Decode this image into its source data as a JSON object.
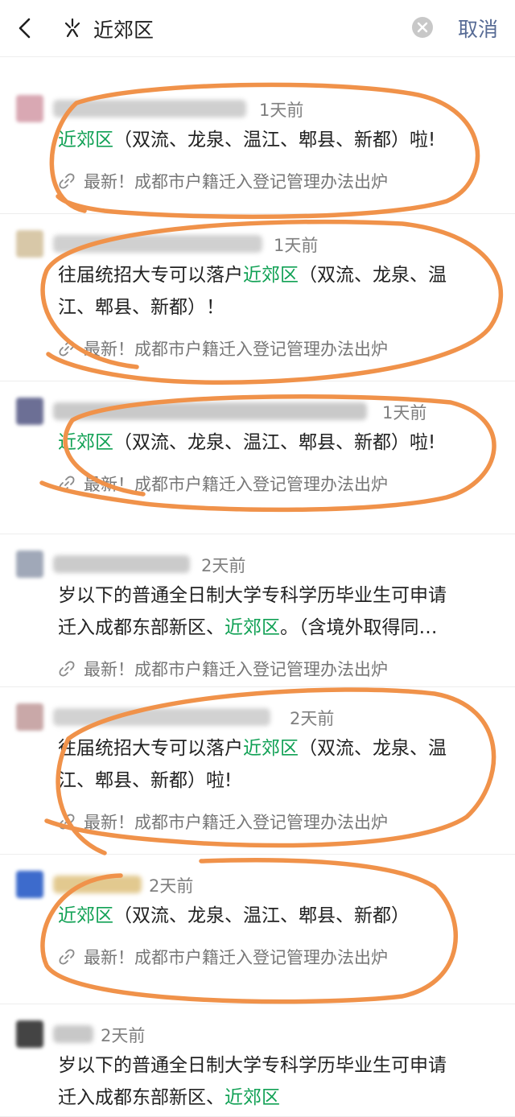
{
  "search": {
    "query": "近郊区",
    "cancel_label": "取消"
  },
  "results": [
    {
      "time": "1天前",
      "text": [
        {
          "t": "近郊区",
          "h": true
        },
        {
          "t": "（双流、龙泉、温江、郫县、新都）啦!",
          "h": false
        }
      ],
      "article_title": "最新！成都市户籍迁入登记管理办法出炉"
    },
    {
      "time": "1天前",
      "text": [
        {
          "t": "往届统招大专可以落户",
          "h": false
        },
        {
          "t": "近郊区",
          "h": true
        },
        {
          "t": "（双流、龙泉、温",
          "h": false
        },
        {
          "t": "\n江、郫县、新都）！",
          "h": false
        }
      ],
      "article_title": "最新！成都市户籍迁入登记管理办法出炉"
    },
    {
      "time": "1天前",
      "text": [
        {
          "t": "近郊区",
          "h": true
        },
        {
          "t": "（双流、龙泉、温江、郫县、新都）啦!",
          "h": false
        }
      ],
      "article_title": "最新！成都市户籍迁入登记管理办法出炉"
    },
    {
      "time": "2天前",
      "text": [
        {
          "t": "岁以下的普通全日制大学专科学历毕业生可申请",
          "h": false
        },
        {
          "t": "\n迁入成都东部新区、",
          "h": false
        },
        {
          "t": "近郊区",
          "h": true
        },
        {
          "t": "。（含境外取得同…",
          "h": false
        }
      ],
      "article_title": "最新！成都市户籍迁入登记管理办法出炉"
    },
    {
      "time": "2天前",
      "text": [
        {
          "t": "往届统招大专可以落户",
          "h": false
        },
        {
          "t": "近郊区",
          "h": true
        },
        {
          "t": "（双流、龙泉、温",
          "h": false
        },
        {
          "t": "\n江、郫县、新都）啦!",
          "h": false
        }
      ],
      "article_title": "最新！成都市户籍迁入登记管理办法出炉"
    },
    {
      "time": "2天前",
      "text": [
        {
          "t": "近郊区",
          "h": true
        },
        {
          "t": "（双流、龙泉、温江、郫县、新都）",
          "h": false
        }
      ],
      "article_title": "最新！成都市户籍迁入登记管理办法出炉"
    },
    {
      "time": "2天前",
      "text": [
        {
          "t": "岁以下的普通全日制大学专科学历毕业生可申请",
          "h": false
        },
        {
          "t": "\n迁入成都东部新区、",
          "h": false
        },
        {
          "t": "近郊区",
          "h": true
        }
      ],
      "article_title": ""
    }
  ],
  "colors": {
    "highlight": "#11a155",
    "cancel": "#576b95",
    "annotation": "#f0924a"
  },
  "icons": {
    "back": "chevron-left-icon",
    "search_type": "sparkle-icon",
    "clear": "clear-circle-icon",
    "link": "link-icon"
  }
}
